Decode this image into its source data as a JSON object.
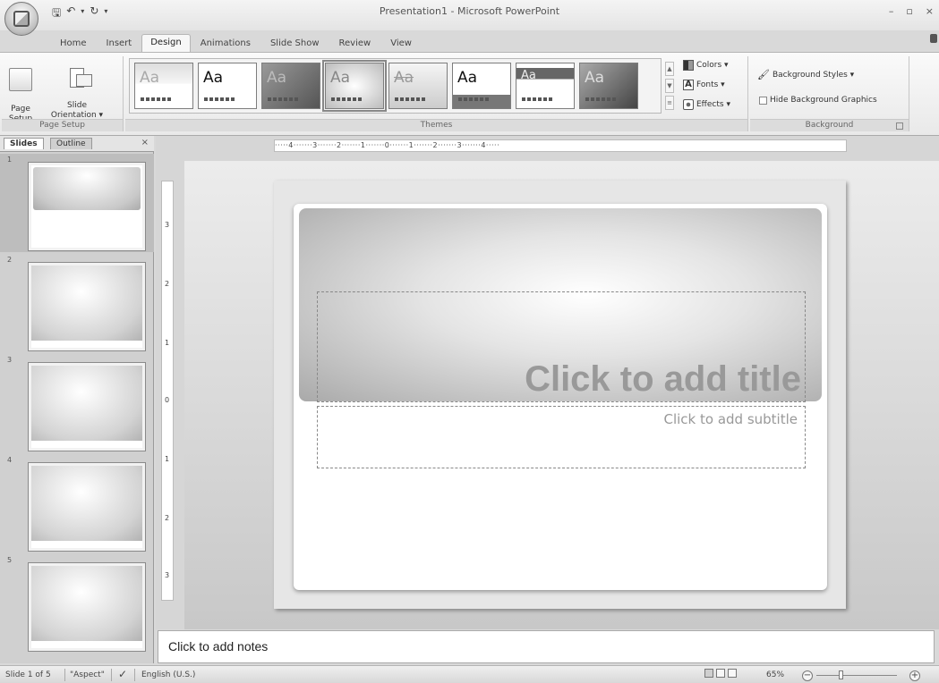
{
  "window": {
    "title": "Presentation1 - Microsoft PowerPoint",
    "controls": [
      "–",
      "▫",
      "×"
    ]
  },
  "qat": {
    "save": "🖫",
    "undo": "↶",
    "undo_drop": "▾",
    "redo": "↻",
    "more": "▾"
  },
  "tabs": [
    "Home",
    "Insert",
    "Design",
    "Animations",
    "Slide Show",
    "Review",
    "View"
  ],
  "active_tab": "Design",
  "ribbon": {
    "page_setup": {
      "page_setup_label": "Page\nSetup",
      "orientation_label": "Slide\nOrientation ▾",
      "group_label": "Page Setup"
    },
    "themes": {
      "group_label": "Themes",
      "items": [
        "Aa",
        "Aa",
        "Aa",
        "Aa",
        "Aa",
        "Aa",
        "Aa",
        "Aa"
      ],
      "colors": "Colors ▾",
      "fonts": "Fonts ▾",
      "effects": "Effects ▾"
    },
    "background": {
      "styles": "Background Styles ▾",
      "hide_graphics": "Hide Background Graphics",
      "group_label": "Background"
    }
  },
  "panel": {
    "tab_slides": "Slides",
    "tab_outline": "Outline",
    "close": "×",
    "slides": [
      "1",
      "2",
      "3",
      "4",
      "5"
    ]
  },
  "ruler": {
    "horizontal": "·····4·······3·······2·······1·······0·······1·······2·······3·······4·····",
    "vertical": [
      "3",
      "2",
      "1",
      "0",
      "1",
      "2",
      "3"
    ]
  },
  "slide": {
    "title_placeholder": "Click to add title",
    "subtitle_placeholder": "Click to add subtitle"
  },
  "notes": {
    "placeholder": "Click to add notes"
  },
  "status": {
    "slide_count": "Slide 1 of 5",
    "theme": "\"Aspect\"",
    "language": "English (U.S.)",
    "zoom": "65%",
    "zoom_out": "−",
    "zoom_in": "+"
  },
  "colors": {
    "ribbon_bg": "#ececec",
    "accent": "#888888"
  }
}
